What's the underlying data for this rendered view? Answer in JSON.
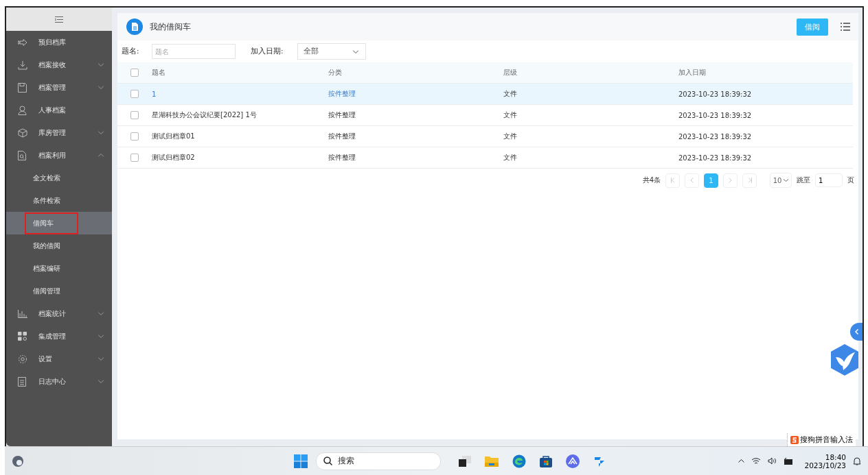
{
  "sidebar": {
    "items": [
      {
        "label": "预归档库"
      },
      {
        "label": "档案接收",
        "expanded": false
      },
      {
        "label": "档案管理",
        "expanded": false
      },
      {
        "label": "人事档案"
      },
      {
        "label": "库房管理",
        "expanded": false
      },
      {
        "label": "档案利用",
        "expanded": true,
        "children": [
          {
            "label": "全文检索",
            "selected": false,
            "annotated": false
          },
          {
            "label": "条件检索",
            "selected": false,
            "annotated": false
          },
          {
            "label": "借阅车",
            "selected": true,
            "annotated": true
          },
          {
            "label": "我的借阅",
            "selected": false,
            "annotated": false
          },
          {
            "label": "档案编研",
            "selected": false,
            "annotated": false
          },
          {
            "label": "借阅管理",
            "selected": false,
            "annotated": false
          }
        ]
      },
      {
        "label": "档案统计",
        "expanded": false
      },
      {
        "label": "集成管理",
        "expanded": false
      },
      {
        "label": "设置",
        "expanded": false
      },
      {
        "label": "日志中心",
        "expanded": false
      }
    ]
  },
  "panel": {
    "title": "我的借阅车",
    "action_button": "借阅"
  },
  "filters": {
    "title_label": "题名:",
    "title_placeholder": "题名",
    "date_label": "加入日期:",
    "date_value": "全部"
  },
  "table": {
    "columns": [
      "题名",
      "分类",
      "层级",
      "加入日期"
    ],
    "header_checked": false,
    "rows": [
      {
        "title": "1",
        "category": "按件整理",
        "level_name": "文件",
        "date": "2023-10-23 18:39:32",
        "checked": false,
        "selected": true
      },
      {
        "title": "星湖科技办公会议纪要[2022] 1号",
        "category": "按件整理",
        "level_name": "文件",
        "date": "2023-10-23 18:39:32",
        "checked": false,
        "selected": false
      },
      {
        "title": "测试归档章01",
        "category": "按件整理",
        "level_name": "文件",
        "date": "2023-10-23 18:39:32",
        "checked": false,
        "selected": false
      },
      {
        "title": "测试归档章02",
        "category": "按件整理",
        "level_name": "文件",
        "date": "2023-10-23 18:39:32",
        "checked": false,
        "selected": false
      }
    ]
  },
  "pagination": {
    "total": "共4条",
    "pages": [
      {
        "label": "1",
        "selected": true
      }
    ],
    "page_size": "10",
    "jump_label": "跳至",
    "jump_value": "1",
    "page_suffix": "页"
  },
  "ime": {
    "label": "搜狗拼音输入法"
  },
  "taskbar": {
    "search_placeholder": "搜索",
    "time": "18:40",
    "date": "2023/10/23"
  }
}
